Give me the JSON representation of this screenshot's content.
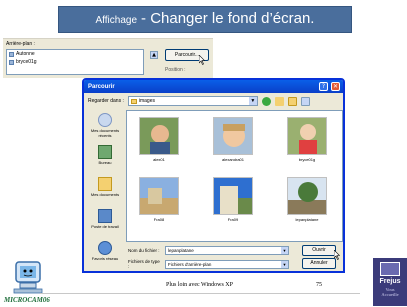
{
  "title": {
    "prefix": "Affichage",
    "main": "- Changer le fond d’écran."
  },
  "background_dialog": {
    "list_label": "Arrière-plan :",
    "items": [
      "Autonne",
      "bryce01g"
    ],
    "browse_button": "Parcourir...",
    "position_label": "Position :"
  },
  "browse_window": {
    "title": "Parcourir",
    "help": "?",
    "close": "✕",
    "lookin_label": "Regarder dans :",
    "lookin_value": "images",
    "places": [
      "Mes documents récents",
      "Bureau",
      "Mes documents",
      "Poste de travail",
      "Favoris réseau"
    ],
    "files": [
      {
        "name": "alex01"
      },
      {
        "name": "alexandra01"
      },
      {
        "name": "bryce01g"
      },
      {
        "name": "Fra08"
      },
      {
        "name": "Fra09"
      },
      {
        "name": "lepanplatane"
      }
    ],
    "filename_label": "Nom du fichier :",
    "filename_value": "lepanplatane",
    "filetype_label": "Fichiers de type :",
    "filetype_value": "Fichiers d'arrière-plan",
    "open_button": "Ouvrir",
    "cancel_button": "Annuler"
  },
  "footer": {
    "center": "Plus loin avec Windows XP",
    "page": "75",
    "brand": "MICROCAM06"
  },
  "crest": {
    "name": "Frejus",
    "tagline": "Vous\nAccueille"
  },
  "colors": {
    "title_bar": "#4a6e9c",
    "xp_blue": "#0a5fe8",
    "brand_green": "#1e6e3a"
  }
}
